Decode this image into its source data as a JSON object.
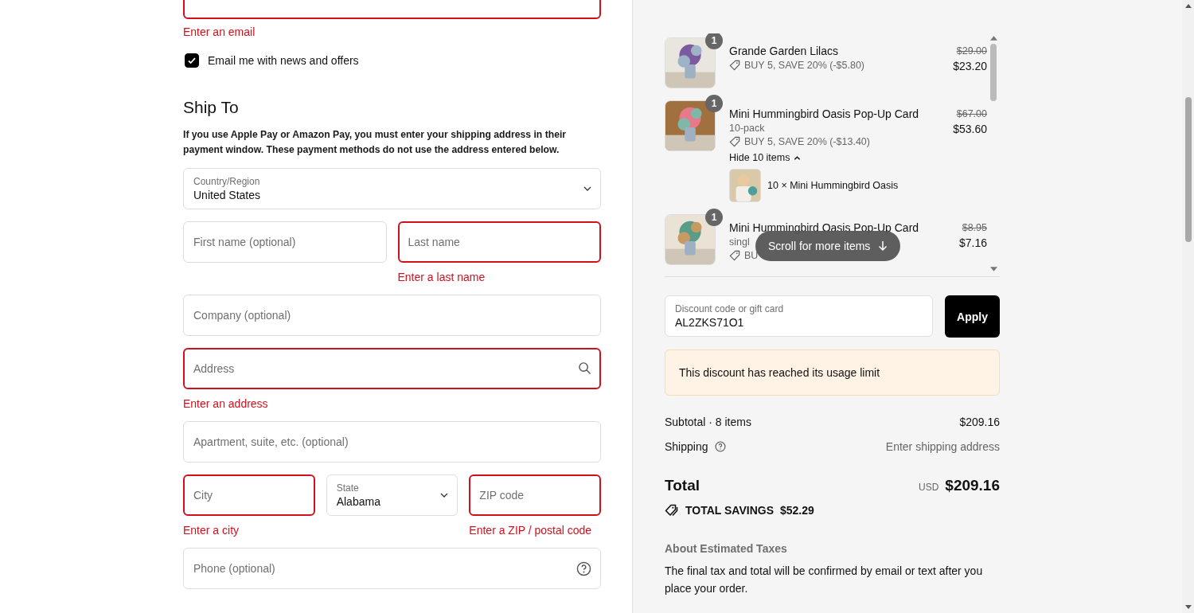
{
  "contact": {
    "email_error": "Enter an email",
    "news_checkbox": {
      "label": "Email me with news and offers",
      "checked": true
    }
  },
  "shipping": {
    "heading": "Ship To",
    "notice": "If you use Apple Pay or Amazon Pay, you must enter your shipping address in their payment window. These payment methods do not use the address entered below.",
    "rows": [
      [
        {
          "kind": "select",
          "label": "Country/Region",
          "value": "United States",
          "invalid": false
        }
      ],
      [
        {
          "kind": "text",
          "placeholder": "First name (optional)",
          "invalid": false
        },
        {
          "kind": "text",
          "placeholder": "Last name",
          "invalid": true,
          "error": "Enter a last name"
        }
      ],
      [
        {
          "kind": "text",
          "placeholder": "Company (optional)",
          "invalid": false
        }
      ],
      [
        {
          "kind": "search",
          "placeholder": "Address",
          "invalid": true,
          "error": "Enter an address"
        }
      ],
      [
        {
          "kind": "text",
          "placeholder": "Apartment, suite, etc. (optional)",
          "invalid": false
        }
      ],
      [
        {
          "kind": "text",
          "placeholder": "City",
          "invalid": true,
          "error": "Enter a city"
        },
        {
          "kind": "select",
          "label": "State",
          "value": "Alabama",
          "invalid": false
        },
        {
          "kind": "text",
          "placeholder": "ZIP code",
          "invalid": true,
          "error": "Enter a ZIP / postal code"
        }
      ],
      [
        {
          "kind": "help",
          "placeholder": "Phone (optional)",
          "invalid": false
        }
      ]
    ]
  },
  "cart": {
    "items": [
      {
        "quantity": "1",
        "title": "Grande Garden Lilacs",
        "discount": "BUY 5, SAVE 20% (-$5.80)",
        "price_original": "$29.00",
        "price": "$23.20"
      },
      {
        "quantity": "1",
        "title": "Mini Hummingbird Oasis Pop-Up Card",
        "variant": "10-pack",
        "discount": "BUY 5, SAVE 20% (-$13.40)",
        "price_original": "$67.00",
        "price": "$53.60",
        "toggle": "Hide 10 items",
        "expanded": true,
        "children": [
          {
            "text": "10 × Mini Hummingbird Oasis"
          }
        ]
      },
      {
        "quantity": "1",
        "title": "Mini Hummingbird Oasis Pop-Up Card",
        "variant": "singl",
        "discount": "BU",
        "price_original": "$8.95",
        "price": "$7.16"
      }
    ],
    "scroll_hint": "Scroll for more items",
    "discount_field": {
      "label": "Discount code or gift card",
      "value": "AL2ZKS71O1"
    },
    "apply_button": "Apply",
    "alert": "This discount has reached its usage limit",
    "subtotal_label": "Subtotal · 8 items",
    "subtotal": "$209.16",
    "shipping_label": "Shipping",
    "shipping_value": "Enter shipping address",
    "total_label": "Total",
    "currency": "USD",
    "total": "$209.16",
    "savings_label": "TOTAL SAVINGS",
    "savings": "$52.29",
    "taxes_heading": "About Estimated Taxes",
    "taxes_text": "The final tax and total will be confirmed by email or text after you place your order."
  }
}
